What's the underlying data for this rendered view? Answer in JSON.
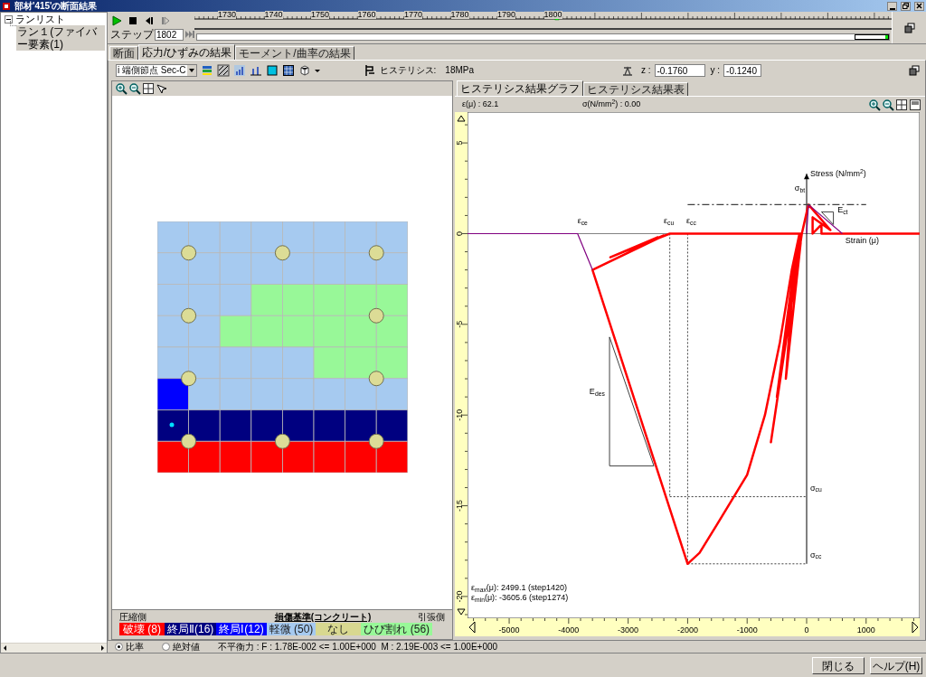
{
  "window": {
    "title": "部材'415'の断面結果"
  },
  "run_tree": {
    "label": "ランリスト",
    "expanded": true,
    "children": [
      {
        "label": "ラン１(ファイバー要素(1)",
        "selected": true
      }
    ]
  },
  "player": {
    "step_label": "ステップ",
    "step_value": "1802",
    "timeline": {
      "ticks": [
        "1730",
        "1740",
        "1750",
        "1760",
        "1770",
        "1780",
        "1790",
        "1800"
      ],
      "level": 0.52
    }
  },
  "tabs": [
    {
      "label": "断面",
      "selected": false
    },
    {
      "label": "応力/ひずみの結果",
      "selected": true
    },
    {
      "label": "モーメント/曲率の結果",
      "selected": false
    }
  ],
  "toolbar": {
    "node_select": "i 端側節点  Sec-C",
    "hysteresis_label": "ヒステリシス:",
    "hysteresis_value": "18MPa",
    "z_label": "z :",
    "z_value": "-0.1760",
    "y_label": "y :",
    "y_value": "-0.1240"
  },
  "section": {
    "rows": [
      [
        {
          "kind": "minor"
        },
        {
          "kind": "minor"
        },
        {
          "kind": "minor"
        },
        {
          "kind": "minor"
        },
        {
          "kind": "minor"
        },
        {
          "kind": "minor"
        },
        {
          "kind": "minor"
        },
        {
          "kind": "minor"
        }
      ],
      [
        {
          "kind": "minor"
        },
        {
          "kind": "minor"
        },
        {
          "kind": "minor"
        },
        {
          "kind": "minor"
        },
        {
          "kind": "minor"
        },
        {
          "kind": "minor"
        },
        {
          "kind": "minor"
        },
        {
          "kind": "minor"
        }
      ],
      [
        {
          "kind": "minor"
        },
        {
          "kind": "minor"
        },
        {
          "kind": "minor"
        },
        {
          "kind": "crack"
        },
        {
          "kind": "crack"
        },
        {
          "kind": "crack"
        },
        {
          "kind": "crack"
        },
        {
          "kind": "crack"
        }
      ],
      [
        {
          "kind": "minor"
        },
        {
          "kind": "minor"
        },
        {
          "kind": "crack"
        },
        {
          "kind": "crack"
        },
        {
          "kind": "crack"
        },
        {
          "kind": "crack"
        },
        {
          "kind": "crack"
        },
        {
          "kind": "crack"
        }
      ],
      [
        {
          "kind": "minor"
        },
        {
          "kind": "minor"
        },
        {
          "kind": "minor"
        },
        {
          "kind": "minor"
        },
        {
          "kind": "minor"
        },
        {
          "kind": "crack"
        },
        {
          "kind": "crack"
        },
        {
          "kind": "crack"
        }
      ],
      [
        {
          "kind": "ultimate1"
        },
        {
          "kind": "minor"
        },
        {
          "kind": "minor"
        },
        {
          "kind": "minor"
        },
        {
          "kind": "minor"
        },
        {
          "kind": "minor"
        },
        {
          "kind": "minor"
        },
        {
          "kind": "minor"
        }
      ],
      [
        {
          "kind": "ultimate2"
        },
        {
          "kind": "ultimate2"
        },
        {
          "kind": "ultimate2"
        },
        {
          "kind": "ultimate2"
        },
        {
          "kind": "ultimate2"
        },
        {
          "kind": "ultimate2"
        },
        {
          "kind": "ultimate2"
        },
        {
          "kind": "ultimate2"
        }
      ],
      [
        {
          "kind": "failure"
        },
        {
          "kind": "failure"
        },
        {
          "kind": "failure"
        },
        {
          "kind": "failure"
        },
        {
          "kind": "failure"
        },
        {
          "kind": "failure"
        },
        {
          "kind": "failure"
        },
        {
          "kind": "failure"
        }
      ]
    ]
  },
  "legend": {
    "left_label": "圧縮側",
    "title": "損傷基準(コンクリート)",
    "right_label": "引張側",
    "items": [
      {
        "label": "破壊 (8)",
        "kind": "failure",
        "color": "#ff0000"
      },
      {
        "label": "終局Ⅱ(16)",
        "kind": "ultimate2",
        "color": "#000080"
      },
      {
        "label": "終局Ⅰ(12)",
        "kind": "ultimate1",
        "color": "#0000ff"
      },
      {
        "label": "軽微 (50)",
        "kind": "minor",
        "color": "#a6caf0"
      },
      {
        "label": "なし",
        "kind": "none",
        "color": "#d8d890"
      },
      {
        "label": "ひび割れ (56)",
        "kind": "crack",
        "color": "#98f898"
      }
    ]
  },
  "graph_tabs": [
    {
      "label": "ヒステリシス結果グラフ",
      "selected": true
    },
    {
      "label": "ヒステリシス結果表",
      "selected": false
    }
  ],
  "readout": {
    "strain": "ε(μ) : 62.1",
    "stress": "σ(N/mm$^{2}$) : 0.00"
  },
  "chart_data": {
    "type": "line",
    "xlabel": "Strain (μ)",
    "ylabel": "Stress (N/mm$^{2}$)",
    "x": [
      -5700,
      -3850,
      -3600,
      -80,
      -2300,
      -3000,
      -2500,
      -3300,
      -2400,
      -3600,
      -2000,
      -1800,
      -1500,
      -1000,
      -700,
      -450,
      -250,
      -120,
      -500,
      -200,
      -350,
      -100,
      -600,
      -80,
      30,
      400,
      100,
      100,
      250,
      250,
      1900,
      0,
      30,
      600,
      -2000,
      1000
    ],
    "series": [
      {
        "color": "#ff0000",
        "values": [
          null,
          null,
          null,
          0,
          0,
          -0.9,
          -0.2,
          -1.3,
          -0.1,
          -2.0,
          -18.2,
          -17.6,
          -16.0,
          -13.3,
          -10.0,
          -6.0,
          -2.0,
          0,
          -9.0,
          -1.5,
          -8.0,
          -0.5,
          -11.5,
          0,
          1.6,
          0.2,
          0.9,
          0,
          0.5,
          0,
          0,
          null,
          null,
          null,
          null,
          null
        ]
      },
      {
        "color": "#800080",
        "values": [
          0,
          0,
          -2.0,
          null,
          null,
          null,
          null,
          null,
          null,
          null,
          null,
          null,
          null,
          null,
          null,
          null,
          null,
          null,
          null,
          null,
          null,
          null,
          null,
          null,
          null,
          null,
          null,
          null,
          null,
          null,
          null,
          0,
          1.6,
          0,
          null,
          null
        ]
      },
      {
        "color": "#404040",
        "line_style": "dashdot",
        "values": [
          null,
          null,
          null,
          null,
          null,
          null,
          null,
          null,
          null,
          null,
          null,
          null,
          null,
          null,
          null,
          null,
          null,
          null,
          null,
          null,
          null,
          null,
          null,
          null,
          null,
          null,
          null,
          null,
          null,
          null,
          null,
          null,
          null,
          null,
          1.6,
          1.6
        ]
      }
    ],
    "xlim": [
      -5700,
      1900
    ],
    "ylim": [
      -21.2,
      6.7
    ],
    "xticks": [
      -5000,
      -4000,
      -3000,
      -2000,
      -1000,
      0,
      1000
    ],
    "yticks": [
      5,
      0,
      -5,
      -10,
      -15,
      -20
    ],
    "annotations": [
      "ε$_{ce}$",
      "ε$_{cu}$",
      "ε$_{cc}$",
      "σ$_{bt}$",
      "E$_{ct}$",
      "E$_{des}$",
      "σ$_{cu}$",
      "σ$_{cc}$"
    ]
  },
  "chart_notes": [
    "ε$_{max}$(μ): 2499.1 (step1420)",
    "ε$_{min}$(μ): -3605.6 (step1274)"
  ],
  "status": {
    "options": [
      {
        "label": "比率",
        "selected": true
      },
      {
        "label": "絶対値",
        "selected": false
      }
    ],
    "message": "不平衡力 : F : 1.78E-002 <= 1.00E+000  M : 2.19E-003 <= 1.00E+000"
  },
  "buttons": [
    {
      "label": "閉じる"
    },
    {
      "label": "ヘルプ(H)"
    }
  ]
}
